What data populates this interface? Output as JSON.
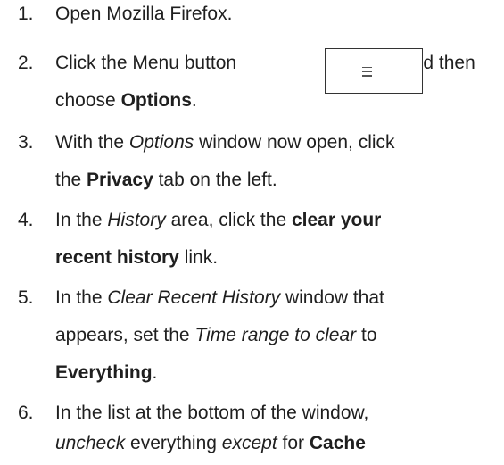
{
  "steps": [
    {
      "number": "1.",
      "lines": [
        [
          {
            "text": "Open Mozilla Firefox.",
            "style": "normal"
          }
        ]
      ]
    },
    {
      "number": "2.",
      "lines": [
        [
          {
            "text": "Click the Menu button",
            "style": "normal"
          }
        ],
        [
          {
            "text": "choose ",
            "style": "normal"
          },
          {
            "text": "Options",
            "style": "bold"
          },
          {
            "text": ".",
            "style": "normal"
          }
        ]
      ],
      "trailing_text": "and then",
      "inline_button": {
        "icon": "hamburger-menu-icon"
      }
    },
    {
      "number": "3.",
      "lines": [
        [
          {
            "text": "With the ",
            "style": "normal"
          },
          {
            "text": "Options",
            "style": "italic"
          },
          {
            "text": " window now open, click",
            "style": "normal"
          }
        ],
        [
          {
            "text": "the ",
            "style": "normal"
          },
          {
            "text": "Privacy",
            "style": "bold"
          },
          {
            "text": " tab on the left.",
            "style": "normal"
          }
        ]
      ]
    },
    {
      "number": "4.",
      "lines": [
        [
          {
            "text": "In the ",
            "style": "normal"
          },
          {
            "text": "History",
            "style": "italic"
          },
          {
            "text": " area, click the ",
            "style": "normal"
          },
          {
            "text": "clear your",
            "style": "bold"
          }
        ],
        [
          {
            "text": "recent history",
            "style": "bold"
          },
          {
            "text": " link.",
            "style": "normal"
          }
        ]
      ]
    },
    {
      "number": "5.",
      "lines": [
        [
          {
            "text": "In the ",
            "style": "normal"
          },
          {
            "text": "Clear Recent History",
            "style": "italic"
          },
          {
            "text": " window that",
            "style": "normal"
          }
        ],
        [
          {
            "text": "appears, set the ",
            "style": "normal"
          },
          {
            "text": "Time range to clear",
            "style": "italic"
          },
          {
            "text": " to",
            "style": "normal"
          }
        ],
        [
          {
            "text": "Everything",
            "style": "bold"
          },
          {
            "text": ".",
            "style": "normal"
          }
        ]
      ]
    },
    {
      "number": "6.",
      "lines": [
        [
          {
            "text": "In the list at the bottom of the window,",
            "style": "normal"
          }
        ],
        [
          {
            "text": "uncheck",
            "style": "italic"
          },
          {
            "text": " everything ",
            "style": "normal"
          },
          {
            "text": "except",
            "style": "italic"
          },
          {
            "text": " for ",
            "style": "normal"
          },
          {
            "text": "Cache",
            "style": "bold"
          }
        ]
      ]
    }
  ]
}
